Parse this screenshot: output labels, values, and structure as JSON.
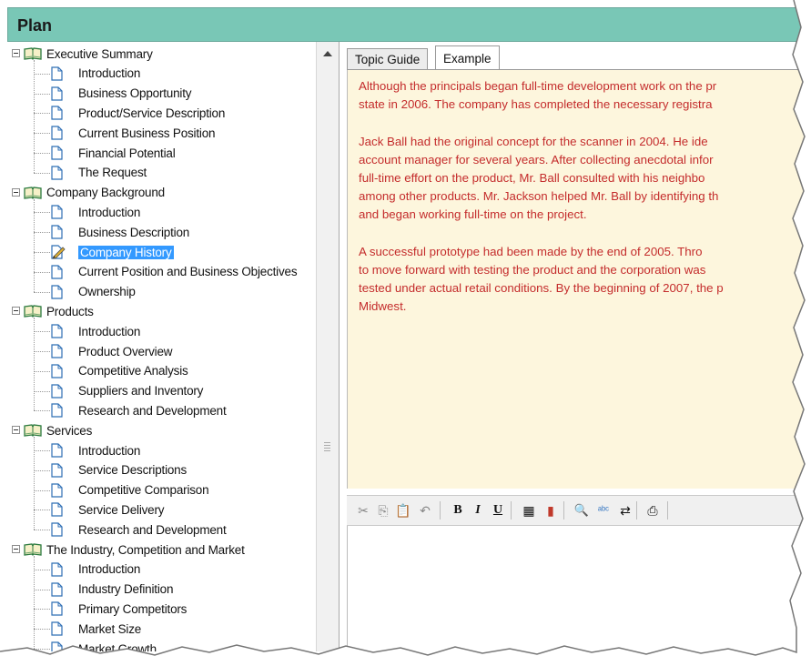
{
  "header": {
    "title": "Plan"
  },
  "tree": {
    "sections": [
      {
        "label": "Executive Summary",
        "items": [
          "Introduction",
          "Business Opportunity",
          "Product/Service Description",
          "Current Business Position",
          "Financial Potential",
          "The Request"
        ]
      },
      {
        "label": "Company Background",
        "items": [
          "Introduction",
          "Business Description",
          "Company History",
          "Current Position and Business Objectives",
          "Ownership"
        ]
      },
      {
        "label": "Products",
        "items": [
          "Introduction",
          "Product Overview",
          "Competitive Analysis",
          "Suppliers and Inventory",
          "Research and Development"
        ]
      },
      {
        "label": "Services",
        "items": [
          "Introduction",
          "Service Descriptions",
          "Competitive Comparison",
          "Service Delivery",
          "Research and Development"
        ]
      },
      {
        "label": "The Industry, Competition and Market",
        "items": [
          "Introduction",
          "Industry Definition",
          "Primary Competitors",
          "Market Size",
          "Market Growth"
        ]
      }
    ],
    "selected": "Company History"
  },
  "tabs": [
    {
      "label": "Topic Guide",
      "active": false
    },
    {
      "label": "Example",
      "active": true
    }
  ],
  "example": {
    "paragraphs": [
      [
        "Although the principals began full-time development work on the pr",
        "state in 2006. The company has completed the necessary registra"
      ],
      [
        "Jack Ball had the original concept for the scanner in 2004. He ide",
        "account manager for several years. After collecting anecdotal infor",
        "full-time effort on the product, Mr. Ball consulted with his neighbo",
        "among other products. Mr. Jackson helped Mr. Ball by identifying th",
        "and began working full-time on the project."
      ],
      [
        "A successful prototype had been made by the end of 2005. Thro",
        "to move forward with testing the product and the corporation was",
        "tested under actual retail conditions. By the beginning of 2007, the p",
        "Midwest."
      ]
    ]
  },
  "toolbar": {
    "buttons": [
      {
        "icon": "cut-icon",
        "glyph": "✂",
        "enabled": false
      },
      {
        "icon": "copy-icon",
        "glyph": "⎘",
        "enabled": false
      },
      {
        "icon": "paste-icon",
        "glyph": "📋",
        "enabled": true
      },
      {
        "icon": "undo-icon",
        "glyph": "↶",
        "enabled": false
      },
      {
        "icon": "bold-icon",
        "glyph": "B",
        "enabled": true
      },
      {
        "icon": "italic-icon",
        "glyph": "I",
        "enabled": true
      },
      {
        "icon": "underline-icon",
        "glyph": "U",
        "enabled": true
      },
      {
        "icon": "table-icon",
        "glyph": "▦",
        "enabled": true
      },
      {
        "icon": "chart-icon",
        "glyph": "▮",
        "enabled": true
      },
      {
        "icon": "find-icon",
        "glyph": "🔍",
        "enabled": true
      },
      {
        "icon": "spellcheck-icon",
        "glyph": "ᵃᵇᶜ",
        "enabled": true
      },
      {
        "icon": "replace-icon",
        "glyph": "⇄",
        "enabled": true
      },
      {
        "icon": "print-icon",
        "glyph": "⎙",
        "enabled": true
      }
    ]
  },
  "colors": {
    "header_bg": "#79c7b6",
    "example_bg": "#fdf6dd",
    "example_text": "#c42c2c",
    "selection": "#3399ff"
  }
}
